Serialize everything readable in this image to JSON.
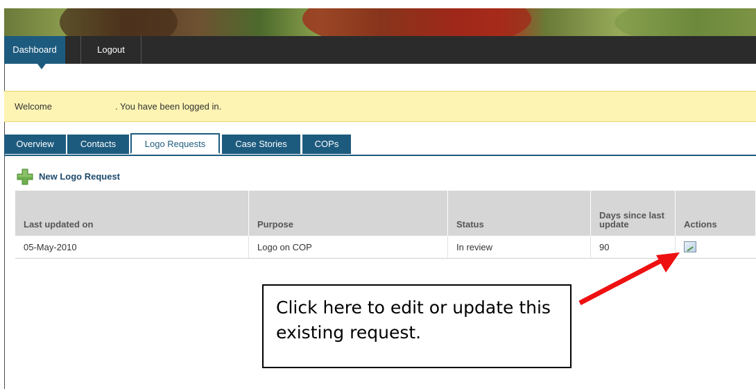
{
  "nav": {
    "dashboard": "Dashboard",
    "logout": "Logout"
  },
  "welcome": {
    "prefix": "Welcome",
    "message": ". You have been logged in."
  },
  "tabs": [
    {
      "label": "Overview"
    },
    {
      "label": "Contacts"
    },
    {
      "label": "Logo Requests",
      "active": true
    },
    {
      "label": "Case Stories"
    },
    {
      "label": "COPs"
    }
  ],
  "new_request_label": "New Logo Request",
  "table": {
    "headers": [
      "Last updated on",
      "Purpose",
      "Status",
      "Days since last update",
      "Actions"
    ],
    "rows": [
      {
        "last_updated": "05-May-2010",
        "purpose": "Logo on COP",
        "status": "In review",
        "days_since": "90",
        "action_icon": "edit-icon"
      }
    ]
  },
  "callout": {
    "text": "Click here to edit or update this existing request."
  },
  "colors": {
    "nav_active": "#1d5b7e",
    "welcome_bg": "#fdf4b3",
    "arrow": "#ee1111"
  }
}
